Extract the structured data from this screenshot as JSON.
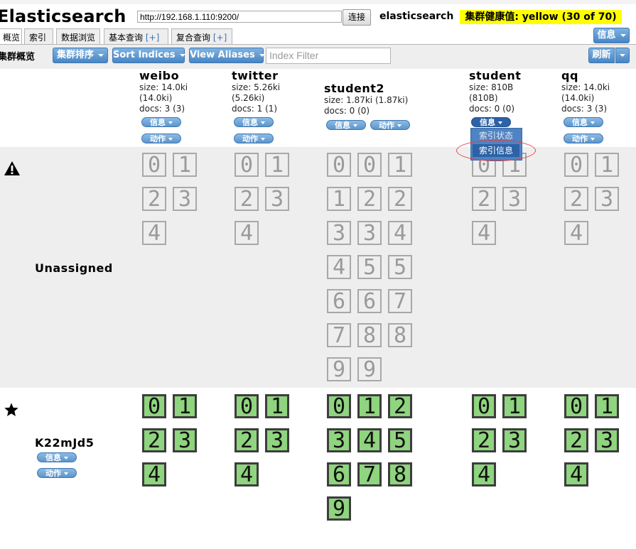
{
  "app": {
    "title": "Elasticsearch",
    "url": "http://192.168.1.110:9200/",
    "connect_label": "连接",
    "cluster_name": "elasticsearch",
    "health": "集群健康值: yellow (30 of 70)"
  },
  "tabs": [
    {
      "label": "概览"
    },
    {
      "label": "索引"
    },
    {
      "label": "数据浏览"
    },
    {
      "label": "基本查询",
      "extra": "[+]"
    },
    {
      "label": "复合查询",
      "extra": "[+]"
    }
  ],
  "header": {
    "info_label": "信息"
  },
  "toolbar": {
    "overview_label": "集群概览",
    "sort_label": "集群排序",
    "sort_indices_label": "Sort Indices",
    "view_aliases_label": "View Aliases",
    "index_filter_placeholder": "Index Filter",
    "refresh_label": "刷新"
  },
  "indices": [
    {
      "name": "weibo",
      "size": "size: 14.0ki",
      "size2": "(14.0ki)",
      "docs": "docs: 3 (3)",
      "info": "信息",
      "action": "动作"
    },
    {
      "name": "twitter",
      "size": "size: 5.26ki",
      "size2": "(5.26ki)",
      "docs": "docs: 1 (1)",
      "info": "信息",
      "action": "动作"
    },
    {
      "name": "student2",
      "size": "size: 1.87ki (1.87ki)",
      "docs": "docs: 0 (0)",
      "info": "信息",
      "action": "动作"
    },
    {
      "name": "student",
      "size": "size: 810B",
      "size2": "(810B)",
      "docs": "docs: 0 (0)",
      "info": "信息",
      "action": "动作"
    },
    {
      "name": "qq",
      "size": "size: 14.0ki",
      "size2": "(14.0ki)",
      "docs": "docs: 3 (3)",
      "info": "信息",
      "action": "动作"
    }
  ],
  "dropdown": {
    "items": [
      "索引状态",
      "索引信息"
    ],
    "highlighted": "索引信息"
  },
  "rows": {
    "unassigned": {
      "label": "Unassigned",
      "icon": "warning-icon"
    },
    "node": {
      "label": "K22mJd5",
      "icon": "star-icon",
      "info": "信息",
      "action": "动作"
    }
  },
  "shards": {
    "unassigned": {
      "weibo": [
        "0",
        "1",
        "2",
        "3",
        "4"
      ],
      "twitter": [
        "0",
        "1",
        "2",
        "3",
        "4"
      ],
      "student2": [
        "0",
        "0",
        "1",
        "1",
        "2",
        "2",
        "3",
        "3",
        "4",
        "4",
        "5",
        "5",
        "6",
        "6",
        "7",
        "7",
        "8",
        "8",
        "9",
        "9"
      ],
      "student": [
        "0",
        "1",
        "2",
        "3",
        "4"
      ],
      "qq": [
        "0",
        "1",
        "2",
        "3",
        "4"
      ]
    },
    "assigned": {
      "weibo": [
        "0",
        "1",
        "2",
        "3",
        "4"
      ],
      "twitter": [
        "0",
        "1",
        "2",
        "3",
        "4"
      ],
      "student2": [
        "0",
        "1",
        "2",
        "3",
        "4",
        "5",
        "6",
        "7",
        "8",
        "9"
      ],
      "student": [
        "0",
        "1",
        "2",
        "3",
        "4"
      ],
      "qq": [
        "0",
        "1",
        "2",
        "3",
        "4"
      ]
    }
  },
  "colors": {
    "health": "#ffff00",
    "assigned_shard": "#8fd47e",
    "button": "#4785c5"
  }
}
